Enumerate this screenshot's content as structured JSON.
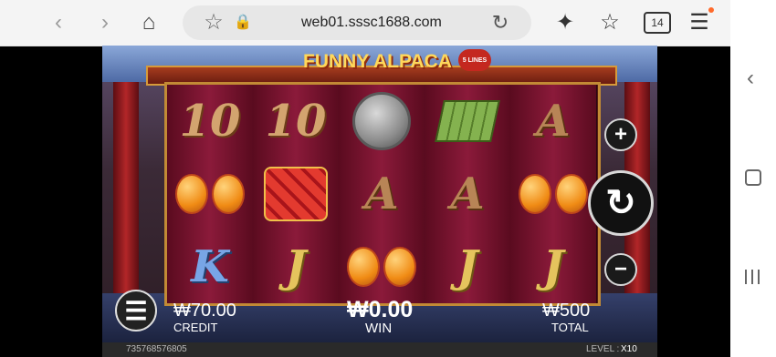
{
  "browser": {
    "url": "web01.sssc1688.com",
    "tabs_count": "14",
    "icons": [
      "back-icon",
      "forward-icon",
      "home-icon",
      "bookmark-star-icon",
      "lock-icon",
      "reload-icon",
      "sparkle-icon",
      "favorites-icon",
      "tabs-icon",
      "menu-icon"
    ]
  },
  "game": {
    "title": "FUNNY ALPACA",
    "lines_badge": "5 LINES",
    "reels": [
      [
        "10",
        "lantern",
        "K"
      ],
      [
        "10",
        "firecrackers",
        "J"
      ],
      [
        "gong",
        "A",
        "lantern"
      ],
      [
        "fans",
        "A",
        "J"
      ],
      [
        "A",
        "lantern",
        "J"
      ]
    ],
    "credit": {
      "amount": "₩70.00",
      "label": "CREDIT"
    },
    "win": {
      "amount": "₩0.00",
      "label": "WIN"
    },
    "total": {
      "amount": "₩500",
      "label": "TOTAL"
    },
    "level_label": "LEVEL :",
    "level_value": "X10",
    "session_id": "735768576805"
  },
  "colors": {
    "accent_gold": "#c28a35",
    "reel_red": "#8b1a3a"
  }
}
